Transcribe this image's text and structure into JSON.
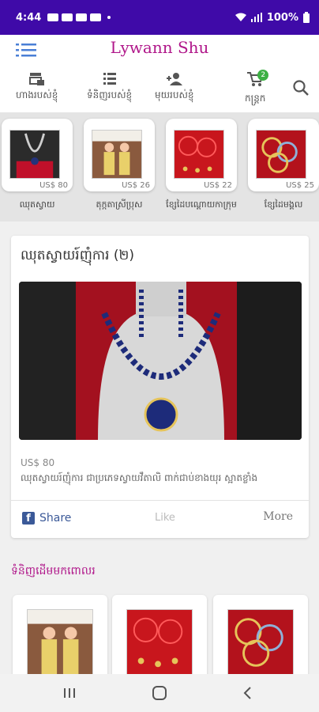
{
  "status_bar": {
    "time": "4:44",
    "battery": "100%"
  },
  "app": {
    "title": "Lywann Shu"
  },
  "nav": {
    "items": [
      {
        "label": "ហាងរបស់ខ្ញុំ",
        "icon": "store-icon"
      },
      {
        "label": "ទំនិញរបស់ខ្ញុំ",
        "icon": "list-icon"
      },
      {
        "label": "មុយរបស់ខ្ញុំ",
        "icon": "people-icon"
      },
      {
        "label": "កន្ត្រក",
        "icon": "cart-icon",
        "badge": "2"
      }
    ]
  },
  "categories": [
    {
      "name": "ឈុតស្វាយ",
      "price": "US$ 80"
    },
    {
      "name": "តុក្កតាស្រីប្រុស",
      "price": "US$ 26"
    },
    {
      "name": "ខ្សែដៃបណ្តោយកាក្រុម",
      "price": "US$ 22"
    },
    {
      "name": "ខ្សែដៃមង្គល",
      "price": "US$ 25"
    }
  ],
  "product": {
    "title": "ឈុតស្វាយរ៍ញុំការ (២)",
    "price": "US$ 80",
    "description": "ឈុតស្វាយរ៍ញុំការ ជាប្រភេទស្វាយវឹតាលិ ពាក់ជាប់ខាងយុរ ស្អាតខ្លាំង",
    "share_label": "Share",
    "like_label": "Like",
    "more_label": "More"
  },
  "recommended": {
    "title": "ទំនិញដើមមកពោលរ"
  },
  "colors": {
    "status_bar": "#3f0aa8",
    "brand": "#b0178a",
    "facebook": "#3b5998",
    "badge": "#3cb043"
  }
}
